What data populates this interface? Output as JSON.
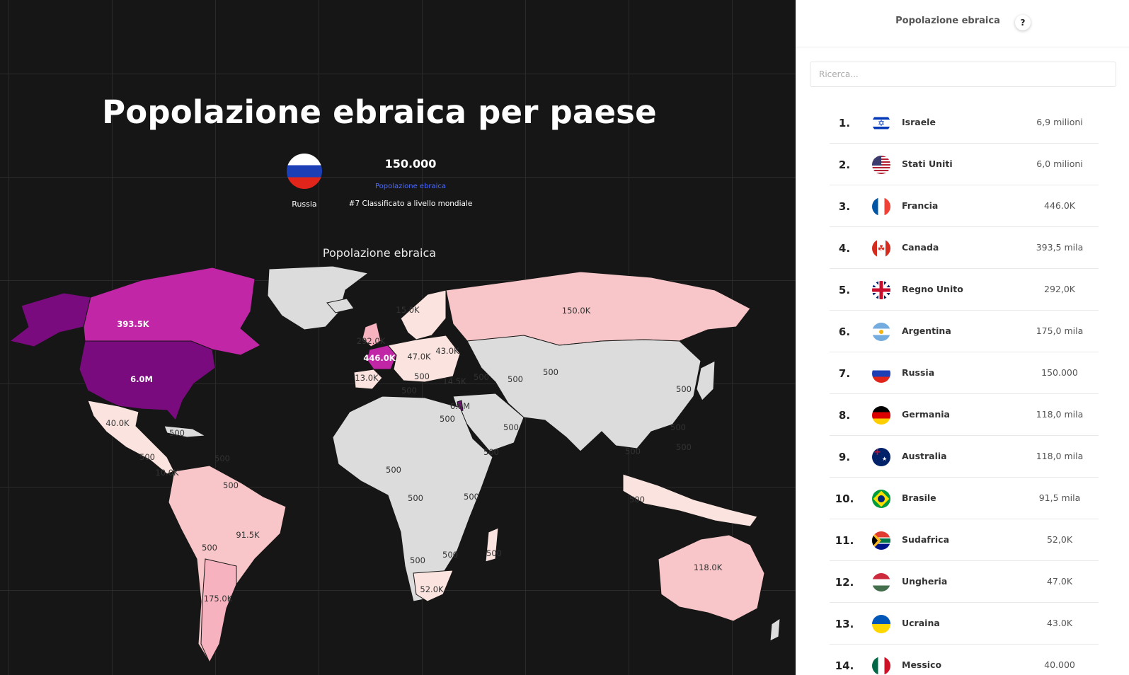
{
  "map": {
    "title": "Popolazione ebraica per paese",
    "selected": {
      "country": "Russia",
      "flag_icon": "russia-flag-icon",
      "value": "150.000",
      "metric_label": "Popolazione ebraica",
      "rank_text": "#7 Classificato a livello mondiale"
    },
    "caption": "Popolazione ebraica",
    "colors": {
      "background": "#161616",
      "no_data": "#dcdcdc",
      "tier_low": "#fbe4df",
      "tier_mid": "#f8c6c8",
      "tier_high": "#f6b3bf",
      "tier_top": "#c026a6",
      "tier_max": "#7a0b7e"
    },
    "labels": [
      {
        "text": "393.5K",
        "country": "Canada"
      },
      {
        "text": "6.0M",
        "country": "Stati Uniti"
      },
      {
        "text": "40.0K",
        "country": "Messico"
      },
      {
        "text": "500"
      },
      {
        "text": "500"
      },
      {
        "text": "500"
      },
      {
        "text": "10.0K"
      },
      {
        "text": "500"
      },
      {
        "text": "91.5K",
        "country": "Brasile"
      },
      {
        "text": "500"
      },
      {
        "text": "175.0K",
        "country": "Argentina"
      },
      {
        "text": "15.0K"
      },
      {
        "text": "292.0K",
        "country": "Regno Unito"
      },
      {
        "text": "446.0K",
        "country": "Francia"
      },
      {
        "text": "47.0K",
        "country": "Ungheria"
      },
      {
        "text": "43.0K",
        "country": "Ucraina"
      },
      {
        "text": "13.0K"
      },
      {
        "text": "500"
      },
      {
        "text": "500"
      },
      {
        "text": "14.5K"
      },
      {
        "text": "500"
      },
      {
        "text": "500"
      },
      {
        "text": "500"
      },
      {
        "text": "6.9M",
        "country": "Israele"
      },
      {
        "text": "500"
      },
      {
        "text": "500"
      },
      {
        "text": "500"
      },
      {
        "text": "150.0K",
        "country": "Russia"
      },
      {
        "text": "500"
      },
      {
        "text": "500"
      },
      {
        "text": "500"
      },
      {
        "text": "500"
      },
      {
        "text": "500"
      },
      {
        "text": "500"
      },
      {
        "text": "500"
      },
      {
        "text": "500"
      },
      {
        "text": "500"
      },
      {
        "text": "500"
      },
      {
        "text": "500"
      },
      {
        "text": "52.0K",
        "country": "Sudafrica"
      },
      {
        "text": "118.0K",
        "country": "Australia"
      }
    ]
  },
  "panel": {
    "title": "Popolazione ebraica",
    "help_label": "?",
    "search_placeholder": "Ricerca...",
    "rows": [
      {
        "rank": "1.",
        "name": "Israele",
        "value": "6,9 milioni",
        "flag": "israel-flag-icon"
      },
      {
        "rank": "2.",
        "name": "Stati Uniti",
        "value": "6,0 milioni",
        "flag": "united-states-flag-icon"
      },
      {
        "rank": "3.",
        "name": "Francia",
        "value": "446.0K",
        "flag": "france-flag-icon"
      },
      {
        "rank": "4.",
        "name": "Canada",
        "value": "393,5 mila",
        "flag": "canada-flag-icon"
      },
      {
        "rank": "5.",
        "name": "Regno Unito",
        "value": "292,0K",
        "flag": "united-kingdom-flag-icon"
      },
      {
        "rank": "6.",
        "name": "Argentina",
        "value": "175,0 mila",
        "flag": "argentina-flag-icon"
      },
      {
        "rank": "7.",
        "name": "Russia",
        "value": "150.000",
        "flag": "russia-flag-icon"
      },
      {
        "rank": "8.",
        "name": "Germania",
        "value": "118,0 mila",
        "flag": "germany-flag-icon"
      },
      {
        "rank": "9.",
        "name": "Australia",
        "value": "118,0 mila",
        "flag": "australia-flag-icon"
      },
      {
        "rank": "10.",
        "name": "Brasile",
        "value": "91,5 mila",
        "flag": "brazil-flag-icon"
      },
      {
        "rank": "11.",
        "name": "Sudafrica",
        "value": "52,0K",
        "flag": "south-africa-flag-icon"
      },
      {
        "rank": "12.",
        "name": "Ungheria",
        "value": "47.0K",
        "flag": "hungary-flag-icon"
      },
      {
        "rank": "13.",
        "name": "Ucraina",
        "value": "43.0K",
        "flag": "ukraine-flag-icon"
      },
      {
        "rank": "14.",
        "name": "Messico",
        "value": "40.000",
        "flag": "mexico-flag-icon"
      }
    ]
  }
}
